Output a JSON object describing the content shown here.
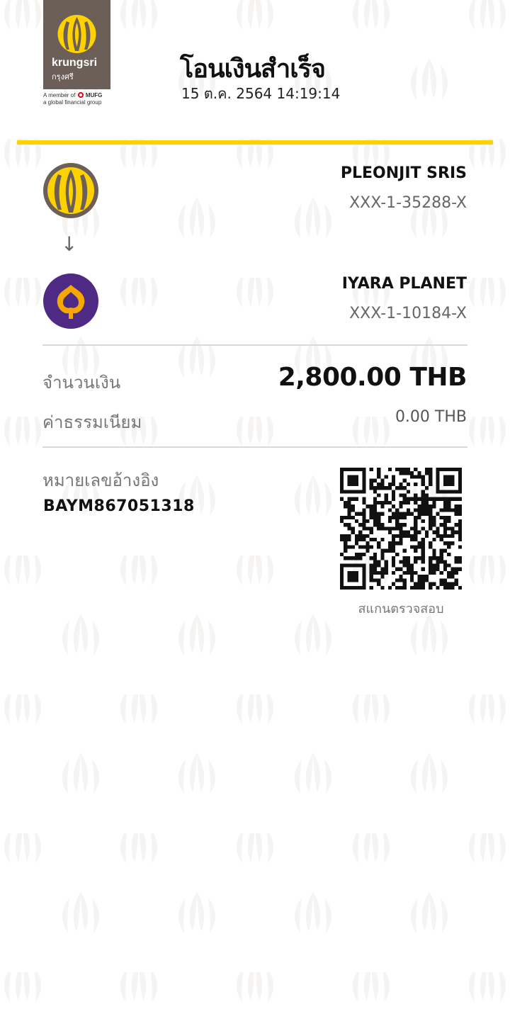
{
  "brand": {
    "logo_word": "krungsri",
    "logo_thai": "กรุงศรี",
    "member_text": "A member of",
    "mufg": "MUFG",
    "tagline": "a global financial group",
    "brand_color": "#6b5f57",
    "accent_color": "#fed100"
  },
  "header": {
    "title": "โอนเงินสำเร็จ",
    "datetime": "15 ต.ค. 2564 14:19:14"
  },
  "sender": {
    "name": "PLEONJIT SRIS",
    "account": "XXX-1-35288-X",
    "icon": "krungsri-bank-icon"
  },
  "transfer_arrow": "↓",
  "receiver": {
    "name": "IYARA PLANET",
    "account": "XXX-1-10184-X",
    "icon": "scb-bank-icon"
  },
  "amount": {
    "label": "จำนวนเงิน",
    "value": "2,800.00 THB"
  },
  "fee": {
    "label": "ค่าธรรมเนียม",
    "value": "0.00 THB"
  },
  "reference": {
    "label": "หมายเลขอ้างอิง",
    "value": "BAYM867051318"
  },
  "qr": {
    "caption": "สแกนตรวจสอบ",
    "icon": "qr-code-icon"
  }
}
